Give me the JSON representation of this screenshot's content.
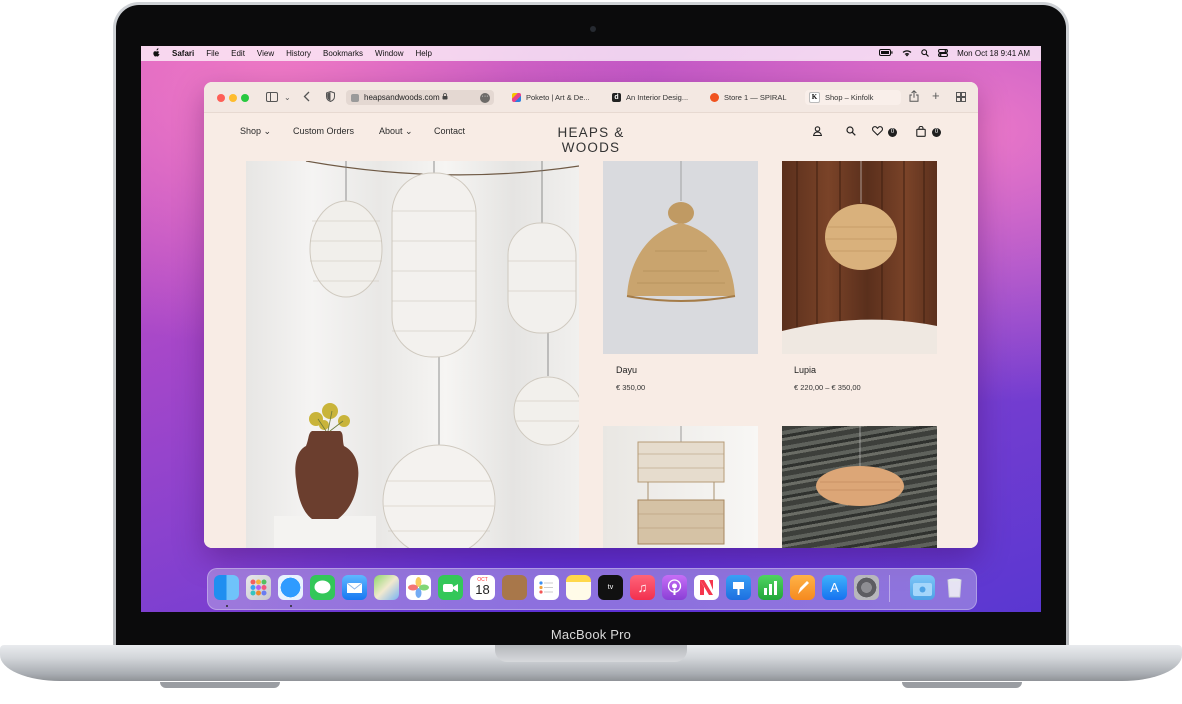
{
  "device": {
    "model_name": "MacBook Pro"
  },
  "menubar": {
    "apple": "",
    "app_name": "Safari",
    "menus": [
      "File",
      "Edit",
      "View",
      "History",
      "Bookmarks",
      "Window",
      "Help"
    ],
    "datetime": "Mon Oct 18  9:41 AM"
  },
  "browser": {
    "address": "heapsandwoods.com",
    "tabs": [
      {
        "label": "Poketo | Art & De...",
        "icon": "poketo-favicon"
      },
      {
        "label": "An Interior Desig...",
        "icon": "d-favicon",
        "glyph": "d"
      },
      {
        "label": "Store 1 — SPIRAL",
        "icon": "spiral-favicon"
      },
      {
        "label": "Shop – Kinfolk",
        "icon": "kinfolk-favicon",
        "glyph": "K"
      }
    ]
  },
  "site": {
    "nav": [
      "Shop",
      "Custom Orders",
      "About",
      "Contact"
    ],
    "brand": "HEAPS & WOODS",
    "wishlist_count": "0",
    "cart_count": "0",
    "products": [
      {
        "name": "Dayu",
        "price": "€ 350,00"
      },
      {
        "name": "Lupia",
        "price": "€ 220,00 – € 350,00"
      }
    ]
  },
  "dock": {
    "calendar_month": "OCT",
    "calendar_day": "18",
    "apps": [
      "Finder",
      "Launchpad",
      "Safari",
      "Messages",
      "Mail",
      "Maps",
      "Photos",
      "FaceTime",
      "Calendar",
      "Notes-Brown",
      "Reminders",
      "Notes",
      "Apple TV",
      "Music",
      "Podcasts",
      "News",
      "Keynote",
      "Numbers",
      "Pages",
      "App Store",
      "System Preferences",
      "Downloads",
      "Trash"
    ]
  }
}
